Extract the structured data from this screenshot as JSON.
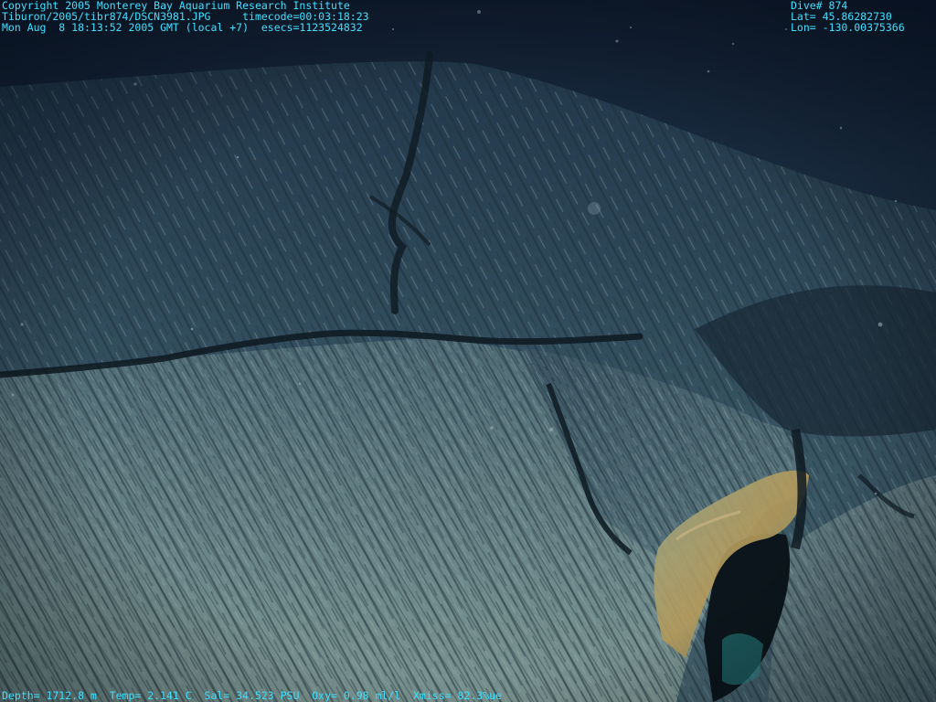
{
  "overlay": {
    "top_left": {
      "line1": "Copyright 2005 Monterey Bay Aquarium Research Institute",
      "line2": "Tiburon/2005/tibr874/DSCN3981.JPG     timecode=00:03:18:23",
      "line3": "Mon Aug  8 18:13:52 2005 GMT (local +7)  esecs=1123524832"
    },
    "top_right": {
      "dive": "Dive# 874",
      "lat": "Lat= 45.86282730",
      "lon": "Lon= -130.00375366"
    },
    "bottom": {
      "telemetry": "Depth= 1712.8 m  Temp= 2.141 C  Sal= 34.523 PSU  Oxy= 0.98 ml/l  Xmiss= 82.3%ue"
    }
  },
  "colors": {
    "overlay_text": "#3fe0ff",
    "water_dark": "#142238",
    "rock_light": "#8aa3a0",
    "crevice": "#0f1c24",
    "sulfide_stain": "#b59a5a"
  }
}
